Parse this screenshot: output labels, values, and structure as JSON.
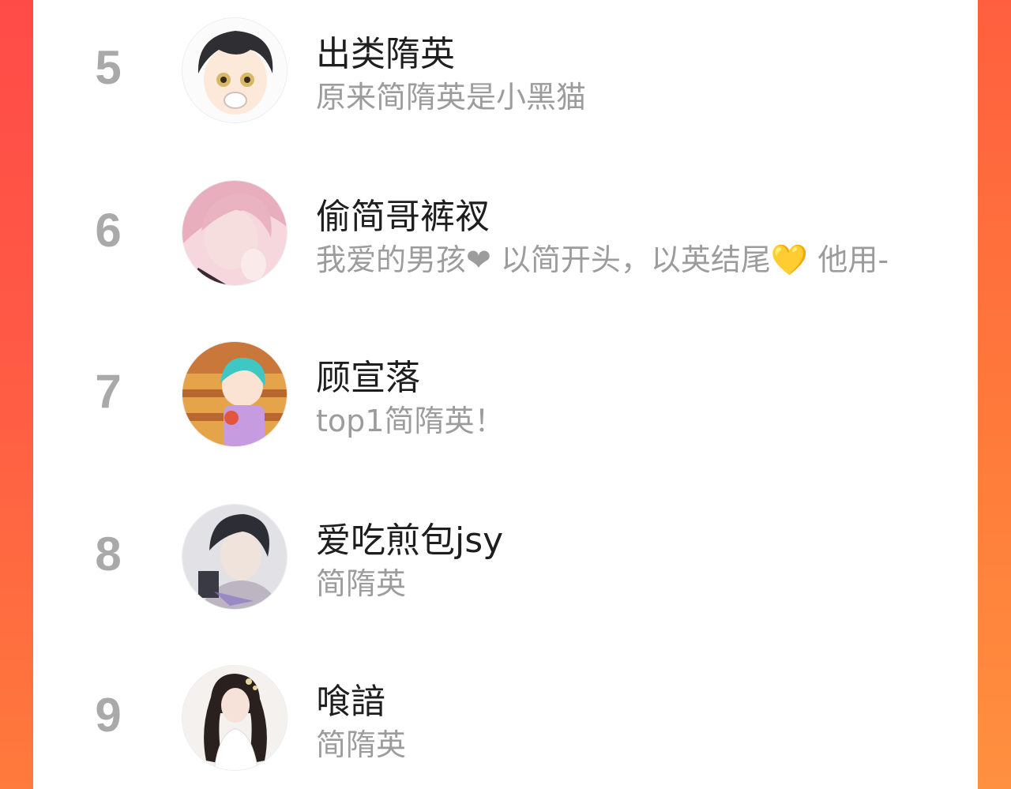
{
  "rankings": [
    {
      "rank": "5",
      "name": "出类隋英",
      "subtitle": "原来简隋英是小黑猫",
      "avatar_icon": "anime-boy-avatar-icon"
    },
    {
      "rank": "6",
      "name": "偷简哥裤衩",
      "subtitle": "我爱的男孩❤ 以简开头，以英结尾💛 他用-",
      "avatar_icon": "pink-hair-avatar-icon"
    },
    {
      "rank": "7",
      "name": "顾宣落",
      "subtitle": "top1简隋英！",
      "avatar_icon": "teal-hair-girl-avatar-icon"
    },
    {
      "rank": "8",
      "name": "爱吃煎包jsy",
      "subtitle": "简隋英",
      "avatar_icon": "dark-hair-man-avatar-icon"
    },
    {
      "rank": "9",
      "name": "喰諳",
      "subtitle": "简隋英",
      "avatar_icon": "long-hair-lady-avatar-icon"
    }
  ],
  "colors": {
    "rank": "#a9a9a9",
    "name": "#1e1e1e",
    "subtitle": "#9c9c9c",
    "edge": "#ff5248"
  }
}
